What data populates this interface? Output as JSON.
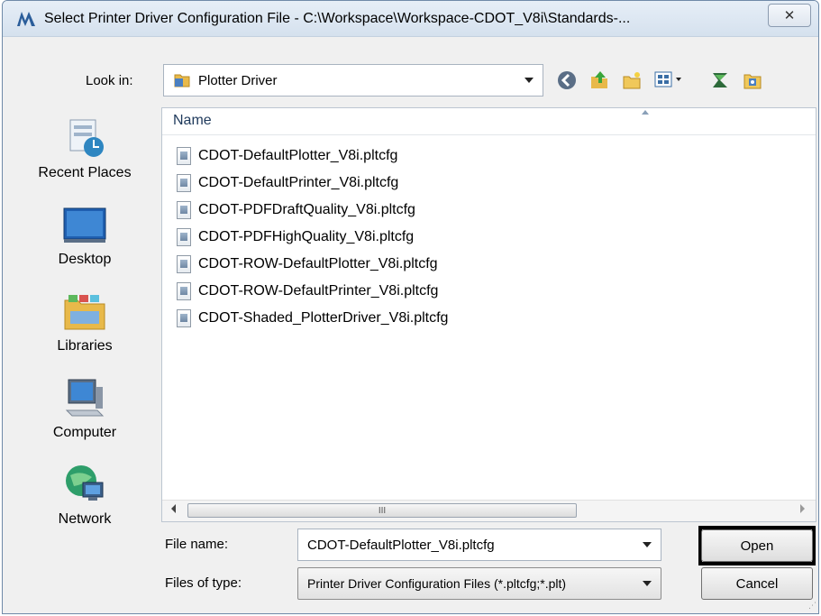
{
  "window": {
    "title": "Select Printer Driver Configuration File - C:\\Workspace\\Workspace-CDOT_V8i\\Standards-...",
    "close_glyph": "✕"
  },
  "look_in": {
    "label": "Look in:",
    "value": "Plotter Driver"
  },
  "toolbar": {
    "icons": [
      "back-icon",
      "up-folder-icon",
      "new-folder-icon",
      "view-menu-icon",
      "app-icon-1",
      "app-icon-2"
    ]
  },
  "places": [
    {
      "label": "Recent Places",
      "icon": "recent-places-icon"
    },
    {
      "label": "Desktop",
      "icon": "desktop-icon"
    },
    {
      "label": "Libraries",
      "icon": "libraries-icon"
    },
    {
      "label": "Computer",
      "icon": "computer-icon"
    },
    {
      "label": "Network",
      "icon": "network-icon"
    }
  ],
  "file_list": {
    "column_name": "Name",
    "files": [
      "CDOT-DefaultPlotter_V8i.pltcfg",
      "CDOT-DefaultPrinter_V8i.pltcfg",
      "CDOT-PDFDraftQuality_V8i.pltcfg",
      "CDOT-PDFHighQuality_V8i.pltcfg",
      "CDOT-ROW-DefaultPlotter_V8i.pltcfg",
      "CDOT-ROW-DefaultPrinter_V8i.pltcfg",
      "CDOT-Shaded_PlotterDriver_V8i.pltcfg"
    ],
    "scroll_thumb_glyph": "III"
  },
  "file_name": {
    "label": "File name:",
    "value": "CDOT-DefaultPlotter_V8i.pltcfg"
  },
  "file_type": {
    "label": "Files of type:",
    "value": "Printer Driver Configuration Files (*.pltcfg;*.plt)"
  },
  "buttons": {
    "open": "Open",
    "cancel": "Cancel"
  },
  "colors": {
    "highlight_border": "#000000",
    "title_bg": "#dfe8f2"
  }
}
